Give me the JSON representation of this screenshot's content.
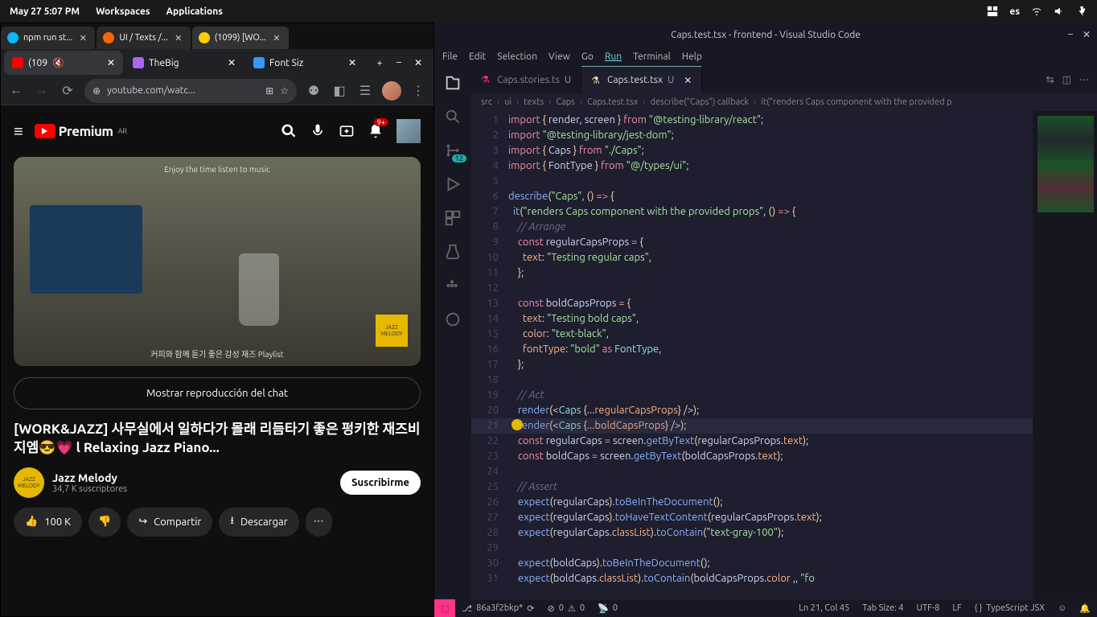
{
  "topbar": {
    "datetime": "May 27  5:07 PM",
    "workspaces": "Workspaces",
    "applications": "Applications",
    "lang": "es"
  },
  "window_tabs": [
    {
      "label": "npm run st...",
      "active": false
    },
    {
      "label": "UI / Texts /...",
      "active": false
    },
    {
      "label": "(1099) [WO...",
      "active": true
    }
  ],
  "browser": {
    "tabs": [
      {
        "label": "(109",
        "fav": "#f00",
        "muted": true,
        "active": true
      },
      {
        "label": "TheBig",
        "fav": "#a6e",
        "active": false
      },
      {
        "label": "Font Siz",
        "fav": "#39f",
        "active": false
      }
    ],
    "url": "youtube.com/watc...",
    "yt": {
      "logo": "Premium",
      "region": "AR",
      "notif": "9+",
      "video_caption_top": "Enjoy the time listen to music",
      "video_caption_bottom": "커피와 함께 듣기 좋은 감성 재즈 Playlist",
      "badge": "JAZZ MELODY",
      "chat_btn": "Mostrar reproducción del chat",
      "title": "[WORK&JAZZ] 사무실에서 일하다가 몰래 리듬타기 좋은 펑키한 재즈비지엠😎💗 l Relaxing Jazz Piano...",
      "channel": "Jazz Melody",
      "subs": "34,7 K suscriptores",
      "subscribe": "Suscribirme",
      "likes": "100 K",
      "share": "Compartir",
      "download": "Descargar"
    }
  },
  "vscode": {
    "title": "Caps.test.tsx - frontend - Visual Studio Code",
    "menu": [
      "File",
      "Edit",
      "Selection",
      "View",
      "Go",
      "Run",
      "Terminal",
      "Help"
    ],
    "tabs": [
      {
        "name": "Caps.stories.ts",
        "modified": "U",
        "active": false
      },
      {
        "name": "Caps.test.tsx",
        "modified": "U",
        "active": true
      }
    ],
    "breadcrumb": [
      "src",
      "ui",
      "texts",
      "Caps",
      "Caps.test.tsx",
      "describe(\"Caps\") callback",
      "it(\"renders Caps component with the provided p"
    ],
    "activity_badge": "12",
    "lines": [
      {
        "n": 1,
        "html": "<span class='k-pink'>import</span> <span class='k-yel'>{</span> <span class='k-wht'>render, screen</span> <span class='k-yel'>}</span> <span class='k-pink'>from</span> <span class='k-grn'>\"@testing-library/react\"</span><span class='k-wht'>;</span>"
      },
      {
        "n": 2,
        "html": "<span class='k-pink'>import</span> <span class='k-grn'>\"@testing-library/jest-dom\"</span><span class='k-wht'>;</span>"
      },
      {
        "n": 3,
        "html": "<span class='k-pink'>import</span> <span class='k-yel'>{</span> <span class='k-wht'>Caps</span> <span class='k-yel'>}</span> <span class='k-pink'>from</span> <span class='k-grn'>\"./Caps\"</span><span class='k-wht'>;</span>"
      },
      {
        "n": 4,
        "html": "<span class='k-pink'>import</span> <span class='k-yel'>{</span> <span class='k-wht'>FontType</span> <span class='k-yel'>}</span> <span class='k-pink'>from</span> <span class='k-grn'>\"@/types/ui\"</span><span class='k-wht'>;</span>"
      },
      {
        "n": 5,
        "html": ""
      },
      {
        "n": 6,
        "html": "<span class='k-blu'>describe</span><span class='k-yel'>(</span><span class='k-grn'>\"Caps\"</span><span class='k-wht'>, </span><span class='k-yel'>()</span> <span class='k-pink'>=&gt;</span> <span class='k-yel'>{</span>"
      },
      {
        "n": 7,
        "html": "  <span class='k-blu'>it</span><span class='k-yel'>(</span><span class='k-grn'>\"renders Caps component with the provided props\"</span><span class='k-wht'>, </span><span class='k-yel'>()</span> <span class='k-pink'>=&gt;</span> <span class='k-yel'>{</span>"
      },
      {
        "n": 8,
        "html": "    <span class='k-gray'>// Arrange</span>"
      },
      {
        "n": 9,
        "html": "    <span class='k-pink'>const</span> <span class='k-wht'>regularCapsProps</span> <span class='k-pink'>=</span> <span class='k-yel'>{</span>"
      },
      {
        "n": 10,
        "html": "      <span class='k-org'>text</span><span class='k-wht'>: </span><span class='k-grn'>\"Testing regular caps\"</span><span class='k-wht'>,</span>"
      },
      {
        "n": 11,
        "html": "    <span class='k-yel'>}</span><span class='k-wht'>;</span>"
      },
      {
        "n": 12,
        "html": ""
      },
      {
        "n": 13,
        "html": "    <span class='k-pink'>const</span> <span class='k-wht'>boldCapsProps</span> <span class='k-pink'>=</span> <span class='k-yel'>{</span>"
      },
      {
        "n": 14,
        "html": "      <span class='k-org'>text</span><span class='k-wht'>: </span><span class='k-grn'>\"Testing bold caps\"</span><span class='k-wht'>,</span>"
      },
      {
        "n": 15,
        "html": "      <span class='k-org'>color</span><span class='k-wht'>: </span><span class='k-grn'>\"text-black\"</span><span class='k-wht'>,</span>"
      },
      {
        "n": 16,
        "html": "      <span class='k-org'>fontType</span><span class='k-wht'>: </span><span class='k-grn'>\"bold\"</span> <span class='k-pink'>as</span> <span class='k-cyan'>FontType</span><span class='k-wht'>,</span>"
      },
      {
        "n": 17,
        "html": "    <span class='k-yel'>}</span><span class='k-wht'>;</span>"
      },
      {
        "n": 18,
        "html": ""
      },
      {
        "n": 19,
        "html": "    <span class='k-gray'>// Act</span>"
      },
      {
        "n": 20,
        "html": "    <span class='k-blu'>render</span><span class='k-yel'>(</span><span class='k-wht'>&lt;</span><span class='k-cyan'>Caps</span> <span class='k-yel'>{</span><span class='k-wht'>...</span><span class='k-org'>regularCapsProps</span><span class='k-yel'>}</span> <span class='k-wht'>/&gt;</span><span class='k-yel'>)</span><span class='k-wht'>;</span>"
      },
      {
        "n": 21,
        "html": "    <span class='k-blu'>render</span><span class='k-yel'>(</span><span class='k-wht'>&lt;</span><span class='k-cyan'>Caps</span> <span class='k-yel'>{</span><span class='k-wht'>...</span><span class='k-org'>boldCapsProps</span><span class='k-yel'>}</span> <span class='k-wht'>/&gt;</span><span class='k-yel'>)</span><span class='k-wht'>;</span>"
      },
      {
        "n": 22,
        "html": "    <span class='k-pink'>const</span> <span class='k-wht'>regularCaps</span> <span class='k-pink'>=</span> <span class='k-wht'>screen.</span><span class='k-blu'>getByText</span><span class='k-yel'>(</span><span class='k-wht'>regularCapsProps.</span><span class='k-org'>text</span><span class='k-yel'>)</span><span class='k-wht'>;</span>"
      },
      {
        "n": 23,
        "html": "    <span class='k-pink'>const</span> <span class='k-wht'>boldCaps</span> <span class='k-pink'>=</span> <span class='k-wht'>screen.</span><span class='k-blu'>getByText</span><span class='k-yel'>(</span><span class='k-wht'>boldCapsProps.</span><span class='k-org'>text</span><span class='k-yel'>)</span><span class='k-wht'>;</span>"
      },
      {
        "n": 24,
        "html": ""
      },
      {
        "n": 25,
        "html": "    <span class='k-gray'>// Assert</span>"
      },
      {
        "n": 26,
        "html": "    <span class='k-blu'>expect</span><span class='k-yel'>(</span><span class='k-wht'>regularCaps</span><span class='k-yel'>)</span><span class='k-wht'>.</span><span class='k-blu'>toBeInTheDocument</span><span class='k-yel'>()</span><span class='k-wht'>;</span>"
      },
      {
        "n": 27,
        "html": "    <span class='k-blu'>expect</span><span class='k-yel'>(</span><span class='k-wht'>regularCaps</span><span class='k-yel'>)</span><span class='k-wht'>.</span><span class='k-blu'>toHaveTextContent</span><span class='k-yel'>(</span><span class='k-wht'>regularCapsProps.</span><span class='k-org'>text</span><span class='k-yel'>)</span><span class='k-wht'>;</span>"
      },
      {
        "n": 28,
        "html": "    <span class='k-blu'>expect</span><span class='k-yel'>(</span><span class='k-wht'>regularCaps.</span><span class='k-org'>classList</span><span class='k-yel'>)</span><span class='k-wht'>.</span><span class='k-blu'>toContain</span><span class='k-yel'>(</span><span class='k-grn'>\"text-gray-100\"</span><span class='k-yel'>)</span><span class='k-wht'>;</span>"
      },
      {
        "n": 29,
        "html": ""
      },
      {
        "n": 30,
        "html": "    <span class='k-blu'>expect</span><span class='k-yel'>(</span><span class='k-wht'>boldCaps</span><span class='k-yel'>)</span><span class='k-wht'>.</span><span class='k-blu'>toBeInTheDocument</span><span class='k-yel'>()</span><span class='k-wht'>;</span>"
      },
      {
        "n": 31,
        "html": "    <span class='k-blu'>expect</span><span class='k-yel'>(</span><span class='k-wht'>boldCaps.</span><span class='k-org'>classList</span><span class='k-yel'>)</span><span class='k-wht'>.</span><span class='k-blu'>toContain</span><span class='k-yel'>(</span><span class='k-wht'>boldCapsProps.</span><span class='k-org'>color</span> <span class='k-wht'>,, </span><span class='k-grn'>\"fo</span>"
      }
    ],
    "status": {
      "branch": "86a3f2bkp*",
      "errors": "0",
      "warnings": "0",
      "ports": "0",
      "cursor": "Ln 21, Col 45",
      "tab": "Tab Size: 4",
      "enc": "UTF-8",
      "eol": "LF",
      "lang": "TypeScript JSX"
    }
  }
}
